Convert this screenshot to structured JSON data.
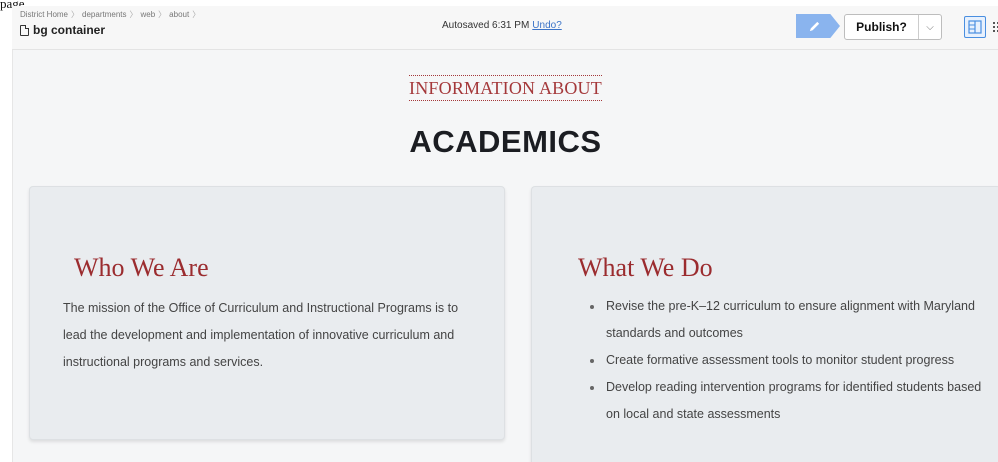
{
  "window": {
    "frame_label": "page."
  },
  "breadcrumb": {
    "items": [
      "District Home",
      "departments",
      "web",
      "about"
    ],
    "separator": "〉"
  },
  "page": {
    "name": "bg container"
  },
  "autosave": {
    "text": "Autosaved 6:31 PM",
    "undo_label": "Undo?"
  },
  "toolbar": {
    "edit_icon": "pencil-icon",
    "publish_label": "Publish?",
    "publish_caret": "⌵",
    "view_split_icon": "split-view-icon",
    "view_list_icon": "list-view-icon"
  },
  "section": {
    "eyebrow": "INFORMATION ABOUT",
    "heading": "ACADEMICS"
  },
  "who_we_are": {
    "title": "Who We Are",
    "body": "The mission of the Office of Curriculum and Instructional Programs is to lead the development and implementation of innovative curriculum and instructional programs and services."
  },
  "what_we_do": {
    "title": "What We Do",
    "items": [
      "Revise the pre-K–12 curriculum to ensure alignment with Maryland standards and outcomes",
      "Create formative assessment tools to monitor student progress",
      "Develop reading intervention programs for identified students based on local and state assessments"
    ]
  },
  "colors": {
    "accent_red": "#9b2c2f",
    "edit_blue": "#8ab4ee",
    "link_blue": "#3b73c7",
    "card_bg": "#e9ecef",
    "page_bg": "#f5f6f7"
  }
}
